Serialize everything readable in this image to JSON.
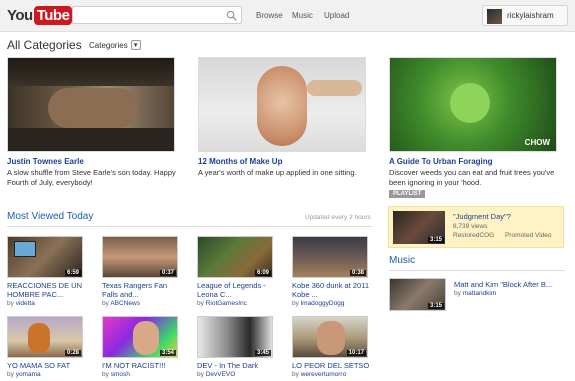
{
  "header": {
    "logo_you": "You",
    "logo_tube": "Tube",
    "search_placeholder": "",
    "nav": [
      "Browse",
      "Music",
      "Upload"
    ],
    "username": "rickylaishram"
  },
  "category": {
    "title": "All Categories",
    "dropdown_label": "Categories",
    "dropdown_icon": "▾"
  },
  "featured": [
    {
      "title": "Justin Townes Earle",
      "desc": "A slow shuffle from Steve Earle's son today. Happy Fourth of July, everybody!"
    },
    {
      "title": "12 Months of Make Up",
      "desc": "A year's worth of make up applied in one sitting."
    },
    {
      "title": "A Guide To Urban Foraging",
      "desc": "Discover weeds you can eat and fruit trees you've been ignoring in your 'hood.",
      "badge": "PLAYLIST",
      "watermark": "CHOW"
    }
  ],
  "most_viewed": {
    "title": "Most Viewed Today",
    "note": "Updated every 2 hours",
    "by_prefix": "by",
    "items": [
      {
        "title": "REACCIONES DE UN HOMBRE PAC...",
        "by": "videtta",
        "duration": "6:59"
      },
      {
        "title": "Texas Rangers Fan Falls and...",
        "by": "ABCNews",
        "duration": "0:37"
      },
      {
        "title": "League of Legends - Leona C...",
        "by": "RiotGamesInc",
        "duration": "6:09"
      },
      {
        "title": "Kobe 360 dunk at 2011 Kobe ...",
        "by": "lmadoggyDogg",
        "duration": "0:38"
      },
      {
        "title": "YO MAMA SO FAT",
        "by": "yomama",
        "duration": "0:28"
      },
      {
        "title": "I'M NOT RACIST!!!",
        "by": "smosh",
        "duration": "3:54"
      },
      {
        "title": "DEV - In The Dark",
        "by": "DevVEVO",
        "duration": "3:45"
      },
      {
        "title": "LO PEOR DEL SETSO",
        "by": "werevertumorro",
        "duration": "10:17"
      }
    ]
  },
  "promoted": {
    "title": "\"Judgment Day\"?",
    "views": "8,739 views",
    "user": "RestoredCOG",
    "label": "Promoted Video",
    "duration": "3:15"
  },
  "music": {
    "title": "Music",
    "video_title": "Matt and Kim \"Block After B...",
    "by_prefix": "by",
    "by": "mattandkim",
    "duration": "3:15"
  }
}
